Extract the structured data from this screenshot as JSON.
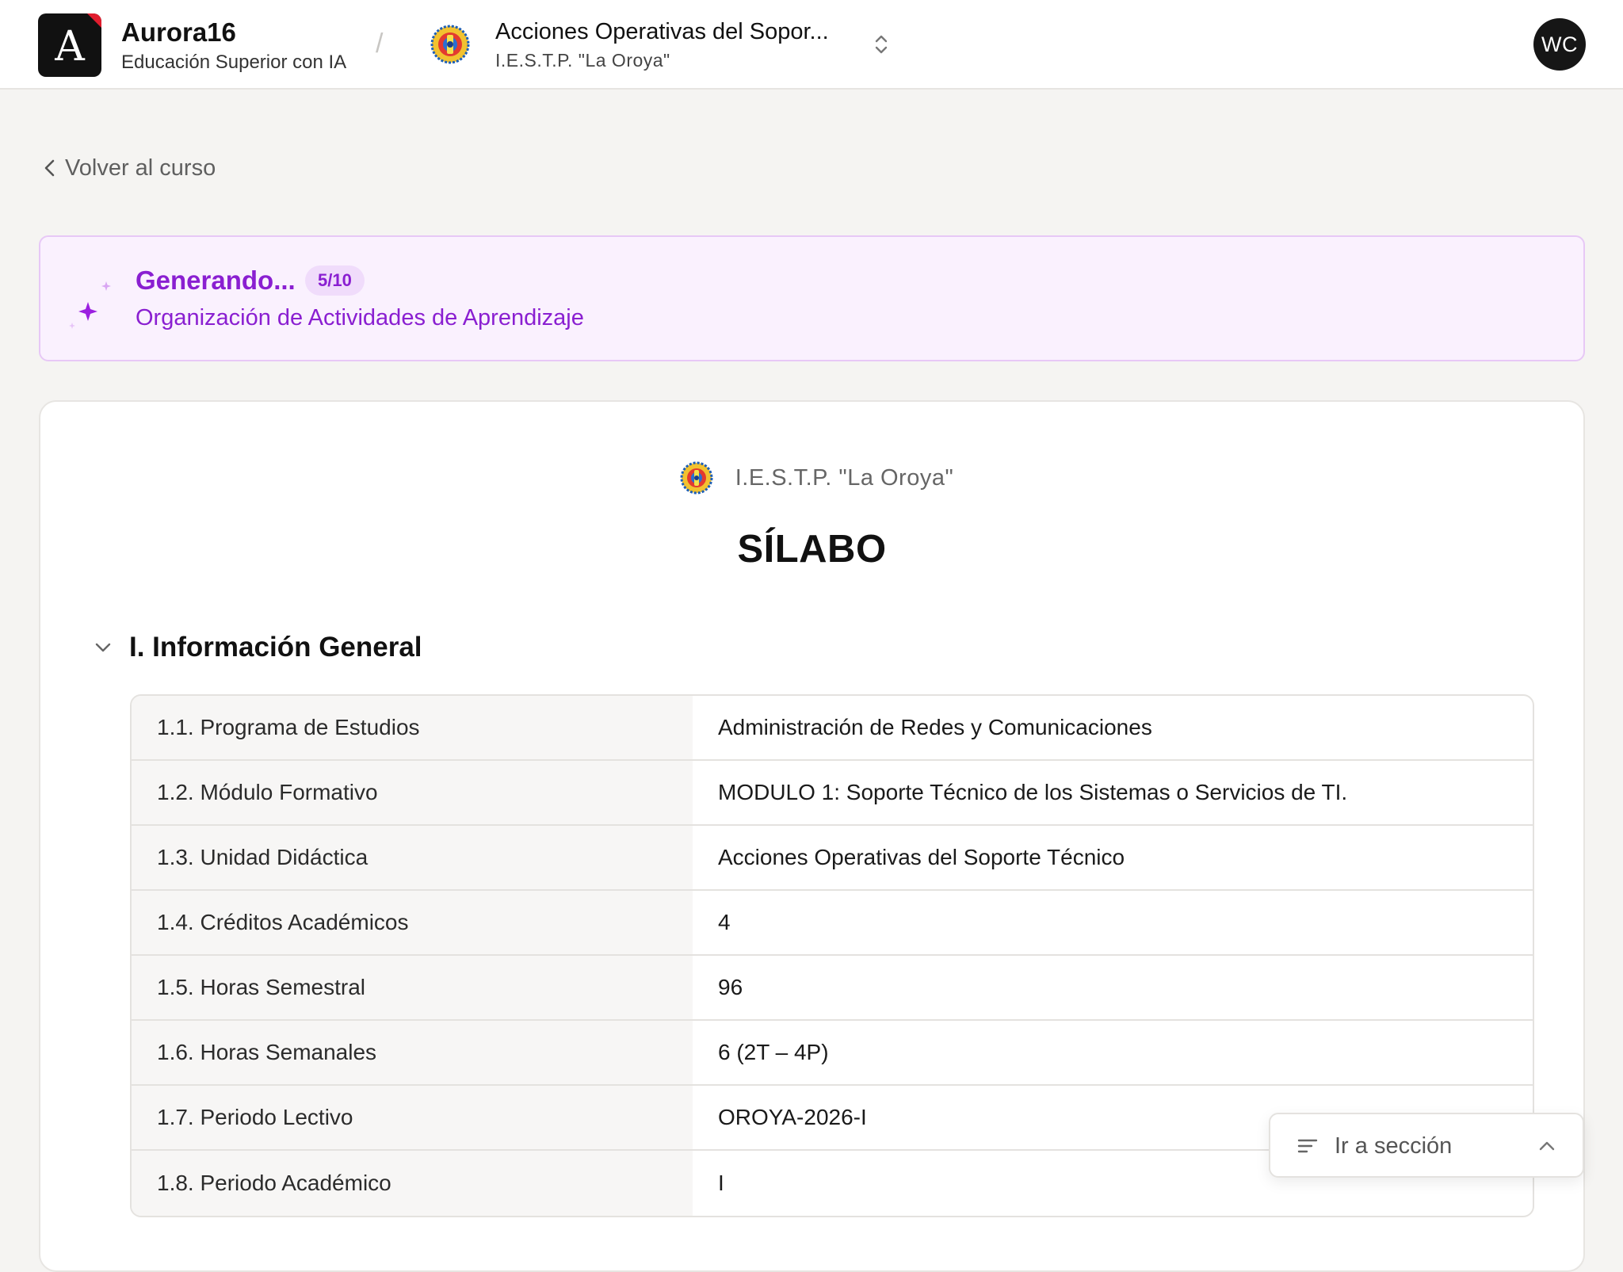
{
  "header": {
    "brand_letter": "A",
    "brand_name": "Aurora16",
    "brand_tagline": "Educación Superior con IA",
    "separator": "/",
    "course_title": "Acciones Operativas del Sopor...",
    "institution": "I.E.S.T.P. \"La Oroya\"",
    "user_initials": "WC"
  },
  "back_link": {
    "label": "Volver al curso"
  },
  "generation": {
    "title": "Generando...",
    "progress_label": "5/10",
    "progress_fraction": 0.5,
    "current_step": "Organización de Actividades de Aprendizaje",
    "accent_color": "#8a1fd1"
  },
  "document": {
    "institution": "I.E.S.T.P. \"La Oroya\"",
    "title": "SÍLABO",
    "section_title": "I. Información General",
    "rows": [
      {
        "label": "1.1. Programa de Estudios",
        "value": "Administración de Redes y Comunicaciones"
      },
      {
        "label": "1.2. Módulo Formativo",
        "value": "MODULO 1: Soporte Técnico de los Sistemas o Servicios de TI."
      },
      {
        "label": "1.3. Unidad Didáctica",
        "value": "Acciones Operativas del Soporte Técnico"
      },
      {
        "label": "1.4. Créditos Académicos",
        "value": "4"
      },
      {
        "label": "1.5. Horas Semestral",
        "value": "96"
      },
      {
        "label": "1.6. Horas Semanales",
        "value": "6 (2T – 4P)"
      },
      {
        "label": "1.7. Periodo Lectivo",
        "value": "OROYA-2026-I"
      },
      {
        "label": "1.8. Periodo Académico",
        "value": "I"
      }
    ]
  },
  "section_jump": {
    "label": "Ir a sección"
  },
  "icons": {
    "back": "chevron-left-icon",
    "switcher": "chevron-up-down-icon",
    "sparkles": "sparkles-icon",
    "collapse": "chevron-down-icon",
    "list": "list-icon",
    "expand": "chevron-up-icon"
  }
}
